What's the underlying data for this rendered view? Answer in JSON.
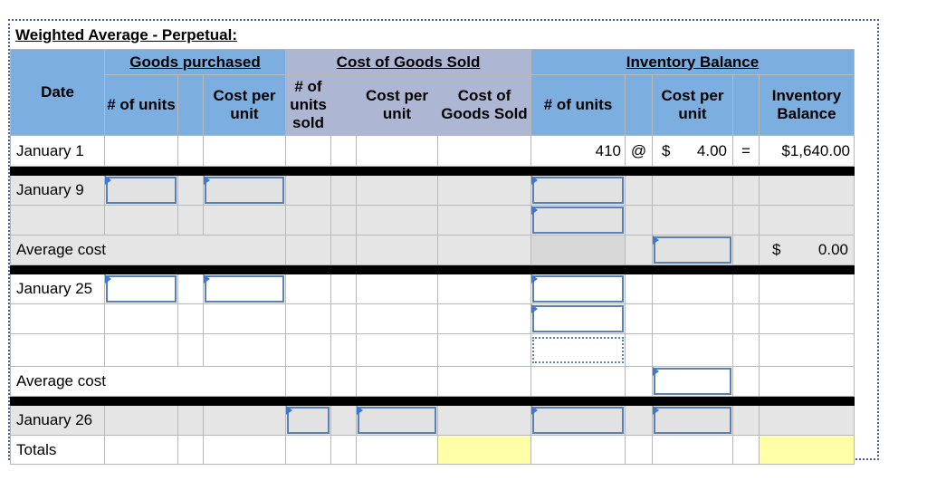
{
  "title": "Weighted Average - Perpetual:",
  "groups": {
    "purchased": "Goods purchased",
    "cogs": "Cost of Goods Sold",
    "inventory": "Inventory Balance"
  },
  "headers": {
    "date": "Date",
    "p_units": "# of units",
    "p_cost": "Cost per unit",
    "s_units": "# of units sold",
    "s_cost": "Cost per unit",
    "s_total": "Cost of Goods Sold",
    "i_units": "# of units",
    "i_cost": "Cost per unit",
    "i_total": "Inventory Balance"
  },
  "rows": {
    "jan1": {
      "label": "January 1",
      "units": "410",
      "at": "@",
      "dollar": "$",
      "cost": "4.00",
      "equals": "=",
      "balance": "$1,640.00"
    },
    "jan9": {
      "label": "January 9"
    },
    "avg1": {
      "label": "Average cost",
      "dollar": "$",
      "balance": "0.00"
    },
    "jan25": {
      "label": "January 25"
    },
    "avg2": {
      "label": "Average cost"
    },
    "jan26": {
      "label": "January 26"
    },
    "totals": {
      "label": "Totals"
    }
  }
}
